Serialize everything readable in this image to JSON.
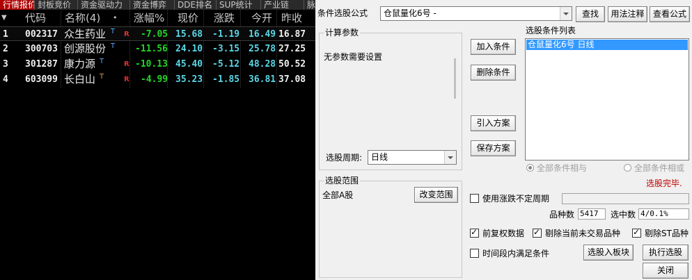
{
  "quote": {
    "tabs": [
      "行情报价",
      "封板竞价",
      "资金驱动力",
      "资金博弈",
      "DDE排名",
      "SUP统计",
      "产业链",
      "脉"
    ],
    "columns": {
      "sort": "▼",
      "code": "代码",
      "name": "名称(4)",
      "dot": "•",
      "change_pct": "涨幅%",
      "price": "现价",
      "change": "涨跌",
      "open": "今开",
      "prev_close": "昨收"
    },
    "rows": [
      {
        "idx": "1",
        "code": "002317",
        "name": "众生药业",
        "t": "T",
        "r": "R",
        "change_pct": "-7.05",
        "price": "15.68",
        "change": "-1.19",
        "open": "16.49",
        "prev_close": "16.87"
      },
      {
        "idx": "2",
        "code": "300703",
        "name": "创源股份",
        "t": "T",
        "r": "",
        "change_pct": "-11.56",
        "price": "24.10",
        "change": "-3.15",
        "open": "25.78",
        "prev_close": "27.25"
      },
      {
        "idx": "3",
        "code": "301287",
        "name": "康力源",
        "t": "T",
        "r": "R",
        "change_pct": "-10.13",
        "price": "45.40",
        "change": "-5.12",
        "open": "48.28",
        "prev_close": "50.52"
      },
      {
        "idx": "4",
        "code": "603099",
        "name": "长白山",
        "t": "T",
        "r": "R",
        "change_pct": "-4.99",
        "price": "35.23",
        "change": "-1.85",
        "open": "36.81",
        "prev_close": "37.08"
      }
    ]
  },
  "dialog": {
    "formula_label": "条件选股公式",
    "formula_value": "仓鼠量化6号  -",
    "find_btn": "查找",
    "usage_btn": "用法注释",
    "view_btn": "查看公式",
    "params_title": "计算参数",
    "params_text": "无参数需要设置",
    "period_label": "选股周期:",
    "period_value": "日线",
    "add_btn": "加入条件",
    "delete_btn": "删除条件",
    "import_btn": "引入方案",
    "save_btn": "保存方案",
    "cond_list_title": "选股条件列表",
    "cond_items": [
      "仓鼠量化6号   日线"
    ],
    "radio_and": "全部条件相与",
    "radio_or": "全部条件相或",
    "status_done": "选股完毕.",
    "range_title": "选股范围",
    "range_text": "全部A股",
    "change_range_btn": "改变范围",
    "use_unfixed_period": "使用涨跌不定周期",
    "count_label": "品种数",
    "count_value": "5417",
    "selected_label": "选中数",
    "selected_value": "4/0.1%",
    "fq_label": "前复权数据",
    "exclude_untraded_label": "剔除当前未交易品种",
    "exclude_st_label": "剔除ST品种",
    "time_range_label": "时间段内满足条件",
    "to_block_btn": "选股入板块",
    "execute_btn": "执行选股",
    "close_btn": "关闭",
    "status_color": "#c00000"
  }
}
